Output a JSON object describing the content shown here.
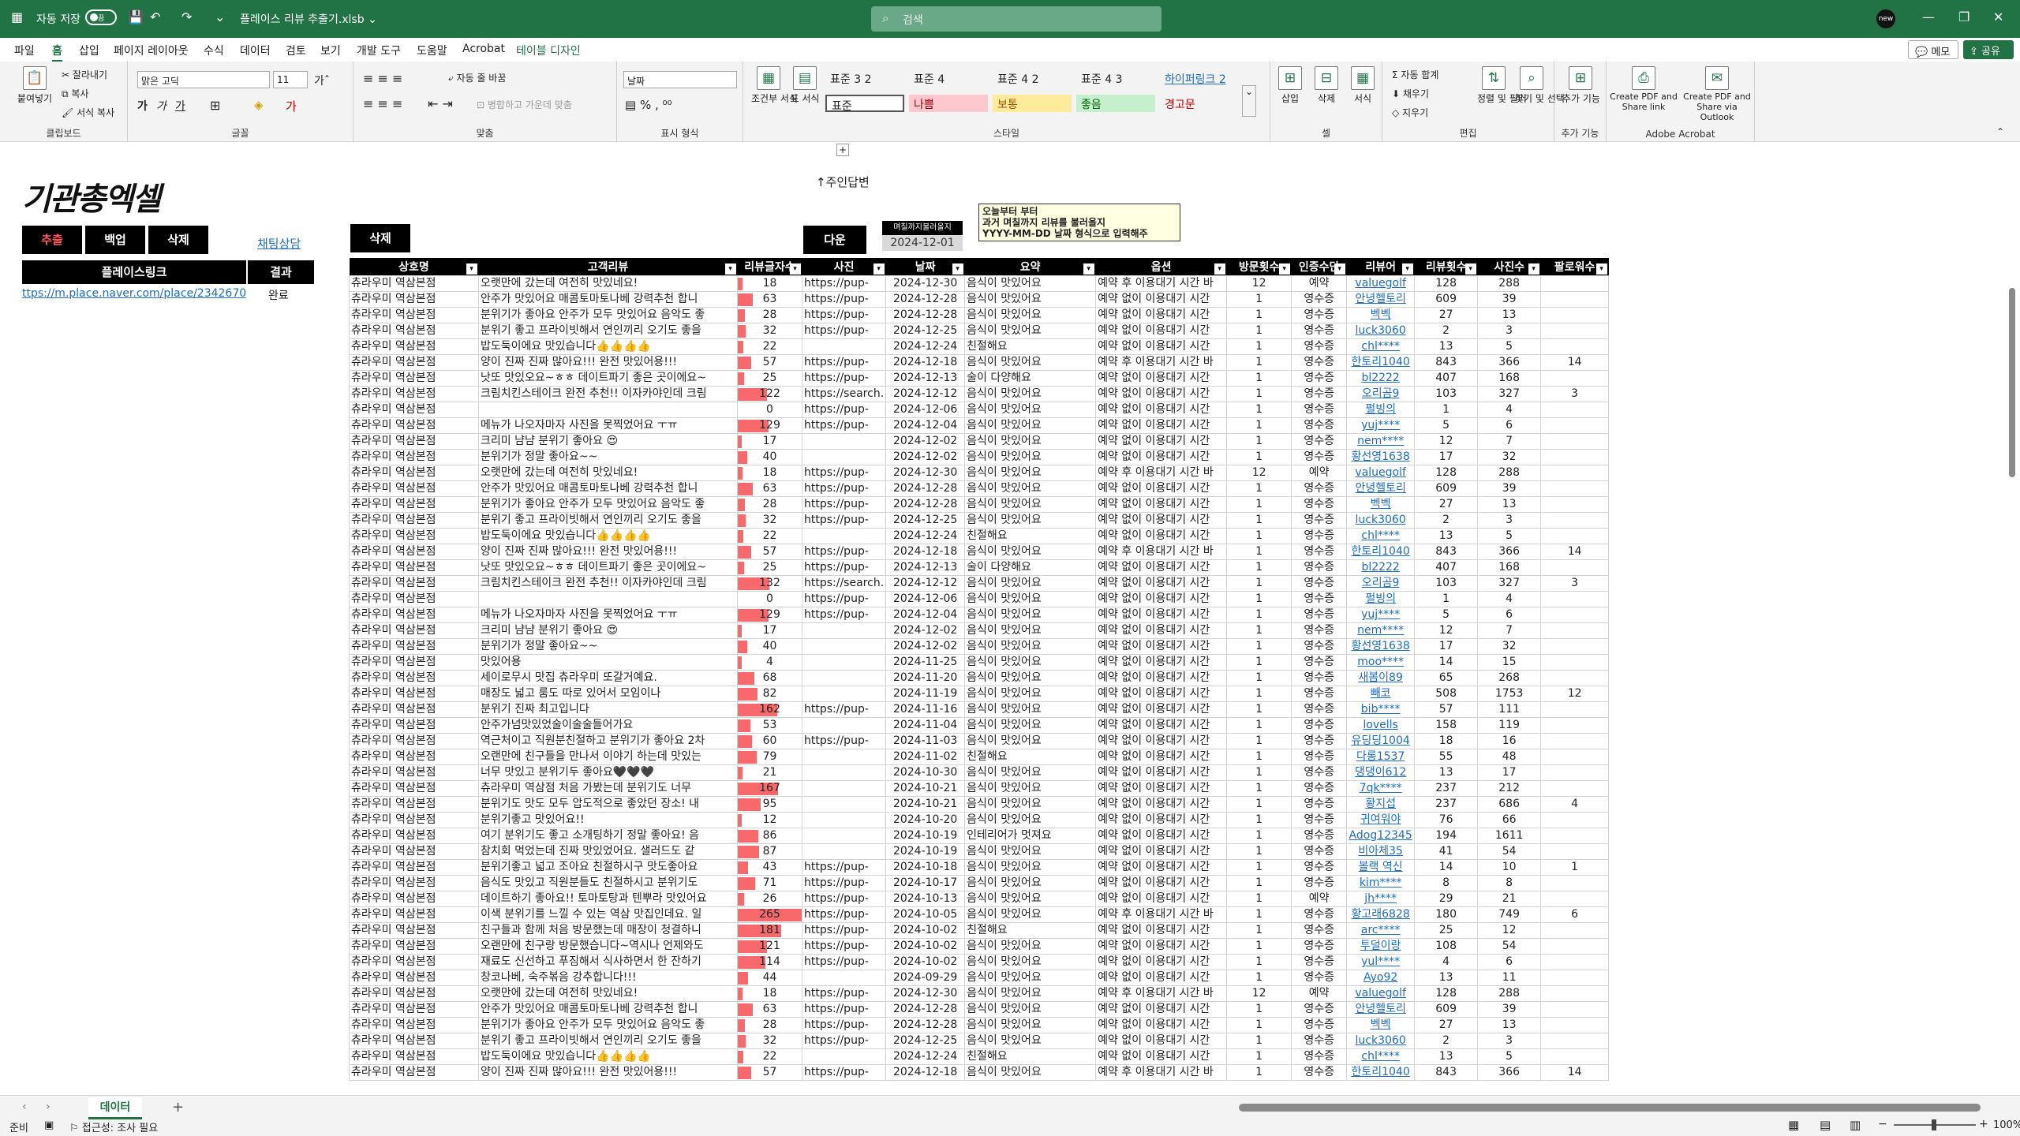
{
  "title": {
    "autosave": "자동 저장",
    "off": "끔",
    "filename": "플레이스 리뷰 추출기.xlsb ⌄",
    "search": "검색",
    "avatar": "new"
  },
  "menu": [
    "파일",
    "홈",
    "삽입",
    "페이지 레이아웃",
    "수식",
    "데이터",
    "검토",
    "보기",
    "개발 도구",
    "도움말",
    "Acrobat",
    "테이블 디자인"
  ],
  "actions": {
    "memo": "메모",
    "share": "공유"
  },
  "ribbon": {
    "paste": "붙여넣기",
    "cut": "잘라내기",
    "copy": "복사",
    "format_painter": "서식 복사",
    "clipboard": "클립보드",
    "font_name": "맑은 고딕",
    "font_size": "11",
    "font": "글꼴",
    "wrap": "자동 줄 바꿈",
    "merge": "병합하고 가운데 맞춤",
    "align": "맞춤",
    "num_format": "날짜",
    "number": "표시 형식",
    "cond": "조건부 서식",
    "table": "표 서식",
    "styles": "스타일",
    "style_cells": [
      "표준 3 2",
      "표준 4",
      "표준 4 2",
      "표준 4 3",
      "하이퍼링크 2",
      "표준",
      "나쁨",
      "보통",
      "좋음",
      "경고문"
    ],
    "insert": "삽입",
    "delete": "삭제",
    "format": "서식",
    "cells": "셀",
    "autosum": "자동 합계",
    "fill": "채우기",
    "clear": "지우기",
    "sort": "정렬 및 필터",
    "find": "찾기 및 선택",
    "edit": "편집",
    "addin": "추가 기능",
    "addin_group": "추가 기능",
    "pdf_link": "Create PDF and Share link",
    "pdf_outlook": "Create PDF and Share via Outlook",
    "acrobat": "Adobe Acrobat"
  },
  "sheet": {
    "logo": "기관총엑셀",
    "reply_label": "↑주인답변",
    "btn_extract": "추출",
    "btn_backup": "백업",
    "btn_delete": "삭제",
    "chat_link": "채팅상담",
    "btn_delete2": "삭제",
    "btn_next": "다운",
    "small_header": "며칠까지불러올지",
    "date_value": "2024-12-01",
    "note_lines": [
      "오늘부터 부터",
      "과거 며칠까지 리뷰를 불러올지",
      "YYYY-MM-DD 날짜 형식으로 입력해주"
    ],
    "place_link_header": "플레이스링크",
    "result_header": "결과",
    "place_link": "ttps://m.place.naver.com/place/234267045",
    "result": "완료"
  },
  "table": {
    "headers": [
      "상호명",
      "고객리뷰",
      "리뷰글자수",
      "사진",
      "날짜",
      "요약",
      "옵션",
      "방문횟수",
      "인증수단",
      "리뷰어",
      "리뷰횟수",
      "사진수",
      "팔로워수"
    ],
    "rows": [
      [
        "츄라우미 역삼본점",
        "오랫만에 갔는데 여전히 맛있네요!",
        18,
        "https://pup-",
        "2024-12-30",
        "음식이 맛있어요",
        "예약 후 이용대기 시간 바",
        "12",
        "예약",
        "valuegolf",
        "128",
        "288",
        ""
      ],
      [
        "츄라우미 역삼본점",
        "안주가 맛있어요 매콤토마토나베 강력추천 합니",
        63,
        "https://pup-",
        "2024-12-28",
        "음식이 맛있어요",
        "예약 없이 이용대기 시간",
        "1",
        "영수증",
        "안녕헬토리",
        "609",
        "39",
        ""
      ],
      [
        "츄라우미 역삼본점",
        "분위기가 좋아요 안주가 모두 맛있어요 음악도 좋",
        28,
        "https://pup-",
        "2024-12-28",
        "음식이 맛있어요",
        "예약 없이 이용대기 시간",
        "1",
        "영수증",
        "벡벡",
        "27",
        "13",
        ""
      ],
      [
        "츄라우미 역삼본점",
        "분위기 좋고 프라이빗해서 연인끼리 오기도 좋을",
        32,
        "https://pup-",
        "2024-12-25",
        "음식이 맛있어요",
        "예약 없이 이용대기 시간",
        "1",
        "영수증",
        "luck3060",
        "2",
        "3",
        ""
      ],
      [
        "츄라우미 역삼본점",
        "밥도둑이에요 맛있습니다👍👍👍👍",
        22,
        "",
        "2024-12-24",
        "친절해요",
        "예약 없이 이용대기 시간",
        "1",
        "영수증",
        "chl****",
        "13",
        "5",
        ""
      ],
      [
        "츄라우미 역삼본점",
        "양이 진짜 진짜 많아요!!! 완전 맛있어용!!!",
        57,
        "https://pup-",
        "2024-12-18",
        "음식이 맛있어요",
        "예약 후 이용대기 시간 바",
        "1",
        "영수증",
        "한토리1040",
        "843",
        "366",
        "14"
      ],
      [
        "츄라우미 역삼본점",
        "낫또 맛있오요~ㅎㅎ 데이트파기 좋은 곳이에요~",
        25,
        "https://pup-",
        "2024-12-13",
        "술이 다양해요",
        "예약 없이 이용대기 시간",
        "1",
        "영수증",
        "bl2222",
        "407",
        "168",
        ""
      ],
      [
        "츄라우미 역삼본점",
        "크림치킨스테이크 완전 추천!! 이자카야인데 크림",
        122,
        "https://search.",
        "2024-12-12",
        "음식이 맛있어요",
        "예약 없이 이용대기 시간",
        "1",
        "영수증",
        "오리곰9",
        "103",
        "327",
        "3"
      ],
      [
        "츄라우미 역삼본점",
        "",
        0,
        "https://pup-",
        "2024-12-06",
        "음식이 맛있어요",
        "예약 없이 이용대기 시간",
        "1",
        "영수증",
        "펄빙의",
        "1",
        "4",
        ""
      ],
      [
        "츄라우미 역삼본점",
        "메뉴가 나오자마자 사진을 못찍었어요 ㅜㅠ",
        129,
        "https://pup-",
        "2024-12-04",
        "음식이 맛있어요",
        "예약 없이 이용대기 시간",
        "1",
        "영수증",
        "yuj****",
        "5",
        "6",
        ""
      ],
      [
        "츄라우미 역삼본점",
        "크리미 냠냠 분위기 좋아요 😍",
        17,
        "",
        "2024-12-02",
        "음식이 맛있어요",
        "예약 없이 이용대기 시간",
        "1",
        "영수증",
        "nem****",
        "12",
        "7",
        ""
      ],
      [
        "츄라우미 역삼본점",
        "분위기가 정말 좋아요~~",
        40,
        "",
        "2024-12-02",
        "음식이 맛있어요",
        "예약 없이 이용대기 시간",
        "1",
        "영수증",
        "황선영1638",
        "17",
        "32",
        ""
      ],
      [
        "츄라우미 역삼본점",
        "오랫만에 갔는데 여전히 맛있네요!",
        18,
        "https://pup-",
        "2024-12-30",
        "음식이 맛있어요",
        "예약 후 이용대기 시간 바",
        "12",
        "예약",
        "valuegolf",
        "128",
        "288",
        ""
      ],
      [
        "츄라우미 역삼본점",
        "안주가 맛있어요 매콤토마토나베 강력추천 합니",
        63,
        "https://pup-",
        "2024-12-28",
        "음식이 맛있어요",
        "예약 없이 이용대기 시간",
        "1",
        "영수증",
        "안녕헬토리",
        "609",
        "39",
        ""
      ],
      [
        "츄라우미 역삼본점",
        "분위기가 좋아요 안주가 모두 맛있어요 음악도 좋",
        28,
        "https://pup-",
        "2024-12-28",
        "음식이 맛있어요",
        "예약 없이 이용대기 시간",
        "1",
        "영수증",
        "벡벡",
        "27",
        "13",
        ""
      ],
      [
        "츄라우미 역삼본점",
        "분위기 좋고 프라이빗해서 연인끼리 오기도 좋을",
        32,
        "https://pup-",
        "2024-12-25",
        "음식이 맛있어요",
        "예약 없이 이용대기 시간",
        "1",
        "영수증",
        "luck3060",
        "2",
        "3",
        ""
      ],
      [
        "츄라우미 역삼본점",
        "밥도둑이에요 맛있습니다👍👍👍👍",
        22,
        "",
        "2024-12-24",
        "친절해요",
        "예약 없이 이용대기 시간",
        "1",
        "영수증",
        "chl****",
        "13",
        "5",
        ""
      ],
      [
        "츄라우미 역삼본점",
        "양이 진짜 진짜 많아요!!! 완전 맛있어용!!!",
        57,
        "https://pup-",
        "2024-12-18",
        "음식이 맛있어요",
        "예약 후 이용대기 시간 바",
        "1",
        "영수증",
        "한토리1040",
        "843",
        "366",
        "14"
      ],
      [
        "츄라우미 역삼본점",
        "낫또 맛있오요~ㅎㅎ 데이트파기 좋은 곳이에요~",
        25,
        "https://pup-",
        "2024-12-13",
        "술이 다양해요",
        "예약 없이 이용대기 시간",
        "1",
        "영수증",
        "bl2222",
        "407",
        "168",
        ""
      ],
      [
        "츄라우미 역삼본점",
        "크림치킨스테이크 완전 추천!! 이자카야인데 크림",
        132,
        "https://search.",
        "2024-12-12",
        "음식이 맛있어요",
        "예약 없이 이용대기 시간",
        "1",
        "영수증",
        "오리곰9",
        "103",
        "327",
        "3"
      ],
      [
        "츄라우미 역삼본점",
        "",
        0,
        "https://pup-",
        "2024-12-06",
        "음식이 맛있어요",
        "예약 없이 이용대기 시간",
        "1",
        "영수증",
        "펄빙의",
        "1",
        "4",
        ""
      ],
      [
        "츄라우미 역삼본점",
        "메뉴가 나오자마자 사진을 못찍었어요 ㅜㅠ",
        129,
        "https://pup-",
        "2024-12-04",
        "음식이 맛있어요",
        "예약 없이 이용대기 시간",
        "1",
        "영수증",
        "yuj****",
        "5",
        "6",
        ""
      ],
      [
        "츄라우미 역삼본점",
        "크리미 냠냠 분위기 좋아요 😍",
        17,
        "",
        "2024-12-02",
        "음식이 맛있어요",
        "예약 없이 이용대기 시간",
        "1",
        "영수증",
        "nem****",
        "12",
        "7",
        ""
      ],
      [
        "츄라우미 역삼본점",
        "분위기가 정말 좋아요~~",
        40,
        "",
        "2024-12-02",
        "음식이 맛있어요",
        "예약 없이 이용대기 시간",
        "1",
        "영수증",
        "황선영1638",
        "17",
        "32",
        ""
      ],
      [
        "츄라우미 역삼본점",
        "맛있어용",
        4,
        "",
        "2024-11-25",
        "음식이 맛있어요",
        "예약 없이 이용대기 시간",
        "1",
        "영수증",
        "moo****",
        "14",
        "15",
        ""
      ],
      [
        "츄라우미 역삼본점",
        "세이로무시 맛집 츄라우미 또갈거예요.",
        68,
        "",
        "2024-11-20",
        "음식이 맛있어요",
        "예약 없이 이용대기 시간",
        "1",
        "영수증",
        "새봄이89",
        "65",
        "268",
        ""
      ],
      [
        "츄라우미 역삼본점",
        "매장도 넓고 룸도 따로 있어서 모임이나",
        82,
        "",
        "2024-11-19",
        "음식이 맛있어요",
        "예약 없이 이용대기 시간",
        "1",
        "영수증",
        "빼코",
        "508",
        "1753",
        "12"
      ],
      [
        "츄라우미 역삼본점",
        "분위기 진짜 최고입니다",
        162,
        "https://pup-",
        "2024-11-16",
        "음식이 맛있어요",
        "예약 없이 이용대기 시간",
        "1",
        "영수증",
        "bib****",
        "57",
        "111",
        ""
      ],
      [
        "츄라우미 역삼본점",
        "안주가넘맛있었술이술술들어가요",
        53,
        "",
        "2024-11-04",
        "음식이 맛있어요",
        "예약 없이 이용대기 시간",
        "1",
        "영수증",
        "lovells",
        "158",
        "119",
        ""
      ],
      [
        "츄라우미 역삼본점",
        "역근처이고 직원분친절하고 분위기가 좋아요 2차",
        60,
        "https://pup-",
        "2024-11-03",
        "음식이 맛있어요",
        "예약 없이 이용대기 시간",
        "1",
        "영수증",
        "유딩딩1004",
        "18",
        "16",
        ""
      ],
      [
        "츄라우미 역삼본점",
        "오랜만에 친구들을 만나서 이야기 하는데 맛있는",
        79,
        "",
        "2024-11-02",
        "친절해요",
        "예약 없이 이용대기 시간",
        "1",
        "영수증",
        "다롱1537",
        "55",
        "48",
        ""
      ],
      [
        "츄라우미 역삼본점",
        "너무 맛있고 분위기두 좋아요🖤🖤🖤",
        21,
        "",
        "2024-10-30",
        "음식이 맛있어요",
        "예약 없이 이용대기 시간",
        "1",
        "영수증",
        "댕댕이612",
        "13",
        "17",
        ""
      ],
      [
        "츄라우미 역삼본점",
        "츄라우미 역삼점 처음 가봤는데 분위기도 너무",
        167,
        "",
        "2024-10-21",
        "음식이 맛있어요",
        "예약 없이 이용대기 시간",
        "1",
        "영수증",
        "7qk****",
        "237",
        "212",
        ""
      ],
      [
        "츄라우미 역삼본점",
        "분위기도 맛도 모두 압도적으로 좋았던 장소! 내",
        95,
        "",
        "2024-10-21",
        "음식이 맛있어요",
        "예약 없이 이용대기 시간",
        "1",
        "영수증",
        "황지섭",
        "237",
        "686",
        "4"
      ],
      [
        "츄라우미 역삼본점",
        "분위기좋고 맛있어요!!",
        12,
        "",
        "2024-10-20",
        "음식이 맛있어요",
        "예약 없이 이용대기 시간",
        "1",
        "영수증",
        "귀여워야",
        "76",
        "66",
        ""
      ],
      [
        "츄라우미 역삼본점",
        "여기 분위기도 좋고 소개팅하기 정말 좋아요! 음",
        86,
        "",
        "2024-10-19",
        "인테리어가 멋져요",
        "예약 없이 이용대기 시간",
        "1",
        "영수증",
        "Adog12345",
        "194",
        "1611",
        ""
      ],
      [
        "츄라우미 역삼본점",
        "참치회 먹었는데 진짜 맛있었어요. 샐러드도 같",
        87,
        "",
        "2024-10-19",
        "음식이 맛있어요",
        "예약 없이 이용대기 시간",
        "1",
        "영수증",
        "비아체35",
        "41",
        "54",
        ""
      ],
      [
        "츄라우미 역삼본점",
        "분위기좋고 넓고 조아요 친절하시구 맛도좋아요",
        43,
        "https://pup-",
        "2024-10-18",
        "음식이 맛있어요",
        "예약 없이 이용대기 시간",
        "1",
        "영수증",
        "볼랙 역신",
        "14",
        "10",
        "1"
      ],
      [
        "츄라우미 역삼본점",
        "음식도 맛있고 직원분들도 친절하시고 분위기도",
        71,
        "https://pup-",
        "2024-10-17",
        "음식이 맛있어요",
        "예약 없이 이용대기 시간",
        "1",
        "영수증",
        "kim****",
        "8",
        "8",
        ""
      ],
      [
        "츄라우미 역삼본점",
        "데이트하기 좋아요!! 토마토탕과 텐뿌라 맛있어요",
        26,
        "https://pup-",
        "2024-10-13",
        "음식이 맛있어요",
        "예약 없이 이용대기 시간",
        "1",
        "예약",
        "jh****",
        "29",
        "21",
        ""
      ],
      [
        "츄라우미 역삼본점",
        "이색 분위기를 느낄 수 있는 역삼 맛집인데요. 일",
        265,
        "https://pup-",
        "2024-10-05",
        "음식이 맛있어요",
        "예약 후 이용대기 시간 바",
        "1",
        "영수증",
        "황고래6828",
        "180",
        "749",
        "6"
      ],
      [
        "츄라우미 역삼본점",
        "친구들과 함께 처음 방문했는데 매장이 청결하니",
        181,
        "https://pup-",
        "2024-10-02",
        "친절해요",
        "예약 없이 이용대기 시간",
        "1",
        "영수증",
        "arc****",
        "25",
        "12",
        ""
      ],
      [
        "츄라우미 역삼본점",
        "오랜만에 친구랑 방문했습니다~역시나 언제와도",
        121,
        "https://pup-",
        "2024-10-02",
        "음식이 맛있어요",
        "예약 없이 이용대기 시간",
        "1",
        "영수증",
        "투덜이랑",
        "108",
        "54",
        ""
      ],
      [
        "츄라우미 역삼본점",
        "재료도 신선하고 푸짐해서 식사하면서 한 잔하기",
        114,
        "https://pup-",
        "2024-10-02",
        "음식이 맛있어요",
        "예약 없이 이용대기 시간",
        "1",
        "영수증",
        "yul****",
        "4",
        "6",
        ""
      ],
      [
        "츄라우미 역삼본점",
        "창코나베, 숙주볶음 강추합니다!!!",
        44,
        "",
        "2024-09-29",
        "음식이 맛있어요",
        "예약 없이 이용대기 시간",
        "1",
        "영수증",
        "Ayo92",
        "13",
        "11",
        ""
      ],
      [
        "츄라우미 역삼본점",
        "오랫만에 갔는데 여전히 맛있네요!",
        18,
        "https://pup-",
        "2024-12-30",
        "음식이 맛있어요",
        "예약 후 이용대기 시간 바",
        "12",
        "예약",
        "valuegolf",
        "128",
        "288",
        ""
      ],
      [
        "츄라우미 역삼본점",
        "안주가 맛있어요 매콤토마토나베 강력추천 합니",
        63,
        "https://pup-",
        "2024-12-28",
        "음식이 맛있어요",
        "예약 없이 이용대기 시간",
        "1",
        "영수증",
        "안녕헬토리",
        "609",
        "39",
        ""
      ],
      [
        "츄라우미 역삼본점",
        "분위기가 좋아요 안주가 모두 맛있어요 음악도 좋",
        28,
        "https://pup-",
        "2024-12-28",
        "음식이 맛있어요",
        "예약 없이 이용대기 시간",
        "1",
        "영수증",
        "벡벡",
        "27",
        "13",
        ""
      ],
      [
        "츄라우미 역삼본점",
        "분위기 좋고 프라이빗해서 연인끼리 오기도 좋을",
        32,
        "https://pup-",
        "2024-12-25",
        "음식이 맛있어요",
        "예약 없이 이용대기 시간",
        "1",
        "영수증",
        "luck3060",
        "2",
        "3",
        ""
      ],
      [
        "츄라우미 역삼본점",
        "밥도둑이에요 맛있습니다👍👍👍👍",
        22,
        "",
        "2024-12-24",
        "친절해요",
        "예약 없이 이용대기 시간",
        "1",
        "영수증",
        "chl****",
        "13",
        "5",
        ""
      ],
      [
        "츄라우미 역삼본점",
        "양이 진짜 진짜 많아요!!! 완전 맛있어용!!!",
        57,
        "https://pup-",
        "2024-12-18",
        "음식이 맛있어요",
        "예약 후 이용대기 시간 바",
        "1",
        "영수증",
        "한토리1040",
        "843",
        "366",
        "14"
      ]
    ]
  },
  "status": {
    "ready": "준비",
    "accessibility": "접근성: 조사 필요",
    "sheet_tab": "데이터",
    "add_sheet": "+",
    "zoom": "100%"
  },
  "colors": {
    "excel_green": "#217346",
    "databar": "#f8696b",
    "link": "#1e6cc6"
  }
}
